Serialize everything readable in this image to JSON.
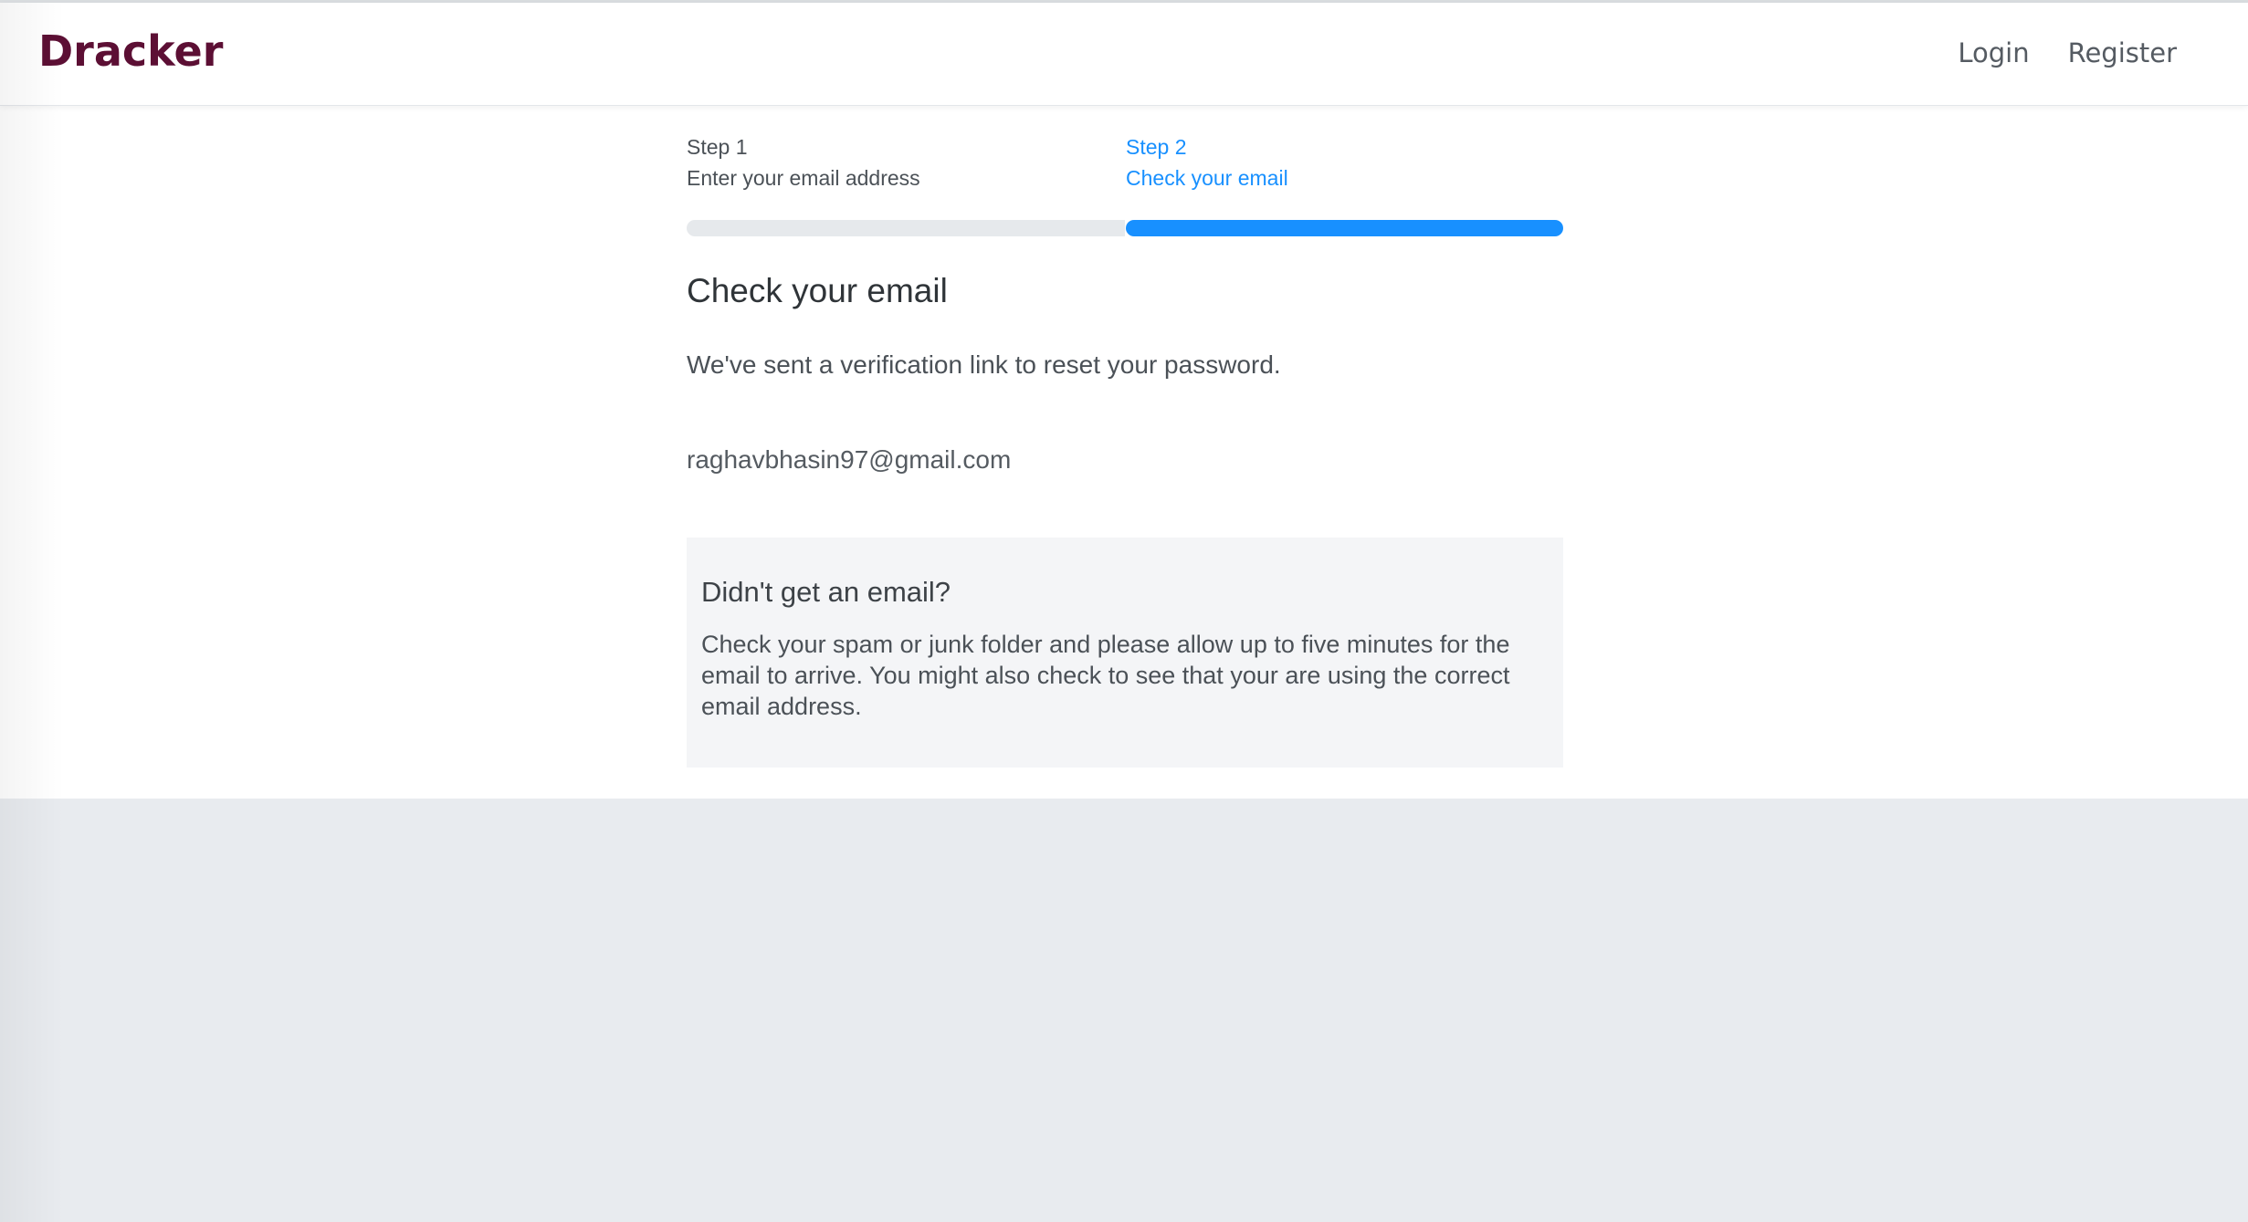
{
  "navbar": {
    "brand": "Dracker",
    "links": [
      {
        "label": "Login"
      },
      {
        "label": "Register"
      }
    ]
  },
  "steps": [
    {
      "number": "Step 1",
      "title": "Enter your email address",
      "state": "done"
    },
    {
      "number": "Step 2",
      "title": "Check your email",
      "state": "current"
    }
  ],
  "progress": {
    "current_step": 2,
    "total_steps": 2
  },
  "main": {
    "title": "Check your email",
    "message": "We've sent a verification link to reset your password.",
    "email": "raghavbhasin97@gmail.com"
  },
  "help": {
    "title": "Didn't get an email?",
    "text": "Check your spam or junk folder and please allow up to five minutes for the email to arrive. You might also check to see that your are using the correct email address."
  },
  "colors": {
    "brand": "#5c0f34",
    "accent": "#1890ff",
    "page_background": "#e8ebef",
    "help_background": "#f4f5f7"
  }
}
